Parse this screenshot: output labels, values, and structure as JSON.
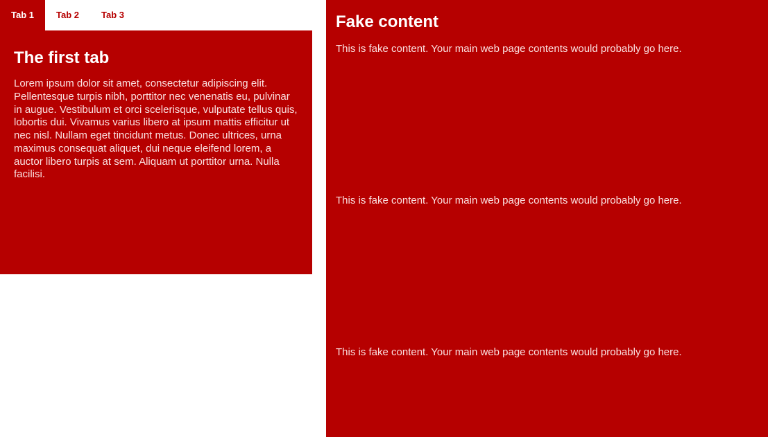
{
  "colors": {
    "brand": "#b60000",
    "text_light": "#fbe1e1",
    "white": "#ffffff"
  },
  "tabs": {
    "items": [
      {
        "label": "Tab 1",
        "active": true
      },
      {
        "label": "Tab 2",
        "active": false
      },
      {
        "label": "Tab 3",
        "active": false
      }
    ]
  },
  "panel": {
    "title": "The first tab",
    "body": "Lorem ipsum dolor sit amet, consectetur adipiscing elit. Pellentesque turpis nibh, porttitor nec venenatis eu, pulvinar in augue. Vestibulum et orci scelerisque, vulputate tellus quis, lobortis dui. Vivamus varius libero at ipsum mattis efficitur ut nec nisl. Nullam eget tincidunt metus. Donec ultrices, urna maximus consequat aliquet, dui neque eleifend lorem, a auctor libero turpis at sem. Aliquam ut porttitor urna. Nulla facilisi."
  },
  "fake": {
    "title": "Fake content",
    "paragraphs": [
      "This is fake content. Your main web page contents would probably go here.",
      "This is fake content. Your main web page contents would probably go here.",
      "This is fake content. Your main web page contents would probably go here."
    ]
  }
}
